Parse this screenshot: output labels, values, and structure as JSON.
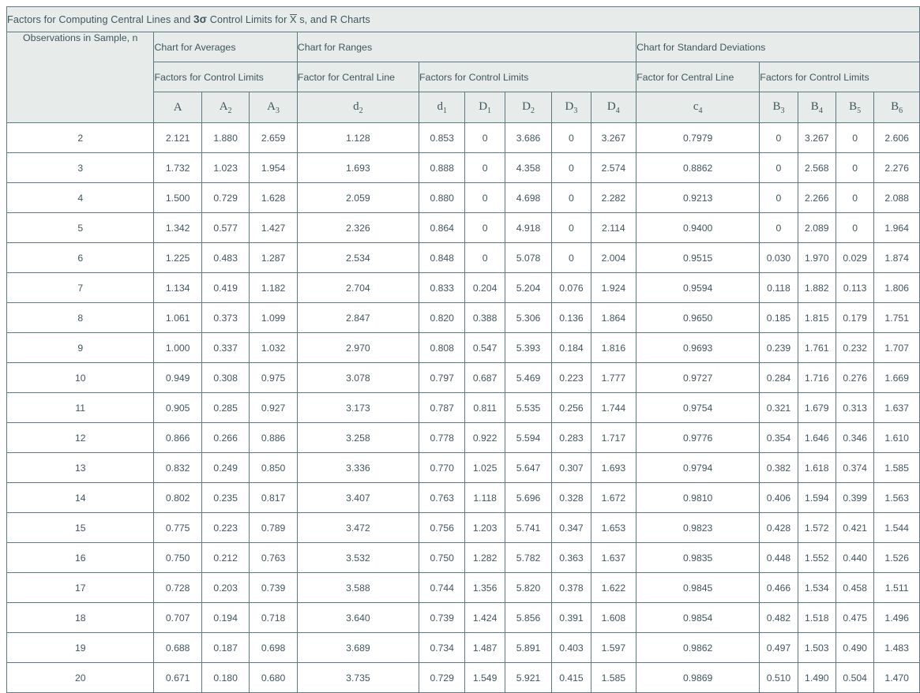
{
  "title": {
    "prefix": "Factors for Computing Central Lines and ",
    "sigma": "3σ",
    "mid": " Control Limits for ",
    "xbar": "X",
    "suffix": " s, and R Charts"
  },
  "header": {
    "obs_label": "Observations in Sample, n",
    "groups": [
      {
        "label": "Chart for Averages",
        "span": 3
      },
      {
        "label": "Chart for Ranges",
        "span": 6
      },
      {
        "label": "Chart for Standard Deviations",
        "span": 5
      }
    ],
    "subgroups": [
      {
        "label": "Factors for Control Limits",
        "span": 3
      },
      {
        "label": "Factor for Central Line",
        "span": 1
      },
      {
        "label": "Factors for Control Limits",
        "span": 5
      },
      {
        "label": "Factor for Central Line",
        "span": 1
      },
      {
        "label": "Factors for Control Limits",
        "span": 4
      }
    ],
    "symbols": [
      {
        "base": "A",
        "sub": ""
      },
      {
        "base": "A",
        "sub": "2"
      },
      {
        "base": "A",
        "sub": "3"
      },
      {
        "base": "d",
        "sub": "2"
      },
      {
        "base": "d",
        "sub": "1"
      },
      {
        "base": "D",
        "sub": "1"
      },
      {
        "base": "D",
        "sub": "2"
      },
      {
        "base": "D",
        "sub": "3"
      },
      {
        "base": "D",
        "sub": "4"
      },
      {
        "base": "c",
        "sub": "4"
      },
      {
        "base": "B",
        "sub": "3"
      },
      {
        "base": "B",
        "sub": "4"
      },
      {
        "base": "B",
        "sub": "5"
      },
      {
        "base": "B",
        "sub": "6"
      }
    ]
  },
  "chart_data": {
    "type": "table",
    "title": "Factors for Computing Central Lines and 3σ Control Limits for X̄ s, and R Charts",
    "columns": [
      "n",
      "A",
      "A2",
      "A3",
      "d2",
      "d1",
      "D1",
      "D2",
      "D3",
      "D4",
      "c4",
      "B3",
      "B4",
      "B5",
      "B6"
    ],
    "rows": [
      [
        "2",
        "2.121",
        "1.880",
        "2.659",
        "1.128",
        "0.853",
        "0",
        "3.686",
        "0",
        "3.267",
        "0.7979",
        "0",
        "3.267",
        "0",
        "2.606"
      ],
      [
        "3",
        "1.732",
        "1.023",
        "1.954",
        "1.693",
        "0.888",
        "0",
        "4.358",
        "0",
        "2.574",
        "0.8862",
        "0",
        "2.568",
        "0",
        "2.276"
      ],
      [
        "4",
        "1.500",
        "0.729",
        "1.628",
        "2.059",
        "0.880",
        "0",
        "4.698",
        "0",
        "2.282",
        "0.9213",
        "0",
        "2.266",
        "0",
        "2.088"
      ],
      [
        "5",
        "1.342",
        "0.577",
        "1.427",
        "2.326",
        "0.864",
        "0",
        "4.918",
        "0",
        "2.114",
        "0.9400",
        "0",
        "2.089",
        "0",
        "1.964"
      ],
      [
        "6",
        "1.225",
        "0.483",
        "1.287",
        "2.534",
        "0.848",
        "0",
        "5.078",
        "0",
        "2.004",
        "0.9515",
        "0.030",
        "1.970",
        "0.029",
        "1.874"
      ],
      [
        "7",
        "1.134",
        "0.419",
        "1.182",
        "2.704",
        "0.833",
        "0.204",
        "5.204",
        "0.076",
        "1.924",
        "0.9594",
        "0.118",
        "1.882",
        "0.113",
        "1.806"
      ],
      [
        "8",
        "1.061",
        "0.373",
        "1.099",
        "2.847",
        "0.820",
        "0.388",
        "5.306",
        "0.136",
        "1.864",
        "0.9650",
        "0.185",
        "1.815",
        "0.179",
        "1.751"
      ],
      [
        "9",
        "1.000",
        "0.337",
        "1.032",
        "2.970",
        "0.808",
        "0.547",
        "5.393",
        "0.184",
        "1.816",
        "0.9693",
        "0.239",
        "1.761",
        "0.232",
        "1.707"
      ],
      [
        "10",
        "0.949",
        "0.308",
        "0.975",
        "3.078",
        "0.797",
        "0.687",
        "5.469",
        "0.223",
        "1.777",
        "0.9727",
        "0.284",
        "1.716",
        "0.276",
        "1.669"
      ],
      [
        "11",
        "0.905",
        "0.285",
        "0.927",
        "3.173",
        "0.787",
        "0.811",
        "5.535",
        "0.256",
        "1.744",
        "0.9754",
        "0.321",
        "1.679",
        "0.313",
        "1.637"
      ],
      [
        "12",
        "0.866",
        "0.266",
        "0.886",
        "3.258",
        "0.778",
        "0.922",
        "5.594",
        "0.283",
        "1.717",
        "0.9776",
        "0.354",
        "1.646",
        "0.346",
        "1.610"
      ],
      [
        "13",
        "0.832",
        "0.249",
        "0.850",
        "3.336",
        "0.770",
        "1.025",
        "5.647",
        "0.307",
        "1.693",
        "0.9794",
        "0.382",
        "1.618",
        "0.374",
        "1.585"
      ],
      [
        "14",
        "0.802",
        "0.235",
        "0.817",
        "3.407",
        "0.763",
        "1.118",
        "5.696",
        "0.328",
        "1.672",
        "0.9810",
        "0.406",
        "1.594",
        "0.399",
        "1.563"
      ],
      [
        "15",
        "0.775",
        "0.223",
        "0.789",
        "3.472",
        "0.756",
        "1.203",
        "5.741",
        "0.347",
        "1.653",
        "0.9823",
        "0.428",
        "1.572",
        "0.421",
        "1.544"
      ],
      [
        "16",
        "0.750",
        "0.212",
        "0.763",
        "3.532",
        "0.750",
        "1.282",
        "5.782",
        "0.363",
        "1.637",
        "0.9835",
        "0.448",
        "1.552",
        "0.440",
        "1.526"
      ],
      [
        "17",
        "0.728",
        "0.203",
        "0.739",
        "3.588",
        "0.744",
        "1.356",
        "5.820",
        "0.378",
        "1.622",
        "0.9845",
        "0.466",
        "1.534",
        "0.458",
        "1.511"
      ],
      [
        "18",
        "0.707",
        "0.194",
        "0.718",
        "3.640",
        "0.739",
        "1.424",
        "5.856",
        "0.391",
        "1.608",
        "0.9854",
        "0.482",
        "1.518",
        "0.475",
        "1.496"
      ],
      [
        "19",
        "0.688",
        "0.187",
        "0.698",
        "3.689",
        "0.734",
        "1.487",
        "5.891",
        "0.403",
        "1.597",
        "0.9862",
        "0.497",
        "1.503",
        "0.490",
        "1.483"
      ],
      [
        "20",
        "0.671",
        "0.180",
        "0.680",
        "3.735",
        "0.729",
        "1.549",
        "5.921",
        "0.415",
        "1.585",
        "0.9869",
        "0.510",
        "1.490",
        "0.504",
        "1.470"
      ]
    ]
  },
  "colors": {
    "header_bg": "#e7eceb",
    "border": "#5c7a80",
    "text": "#4a6168"
  }
}
